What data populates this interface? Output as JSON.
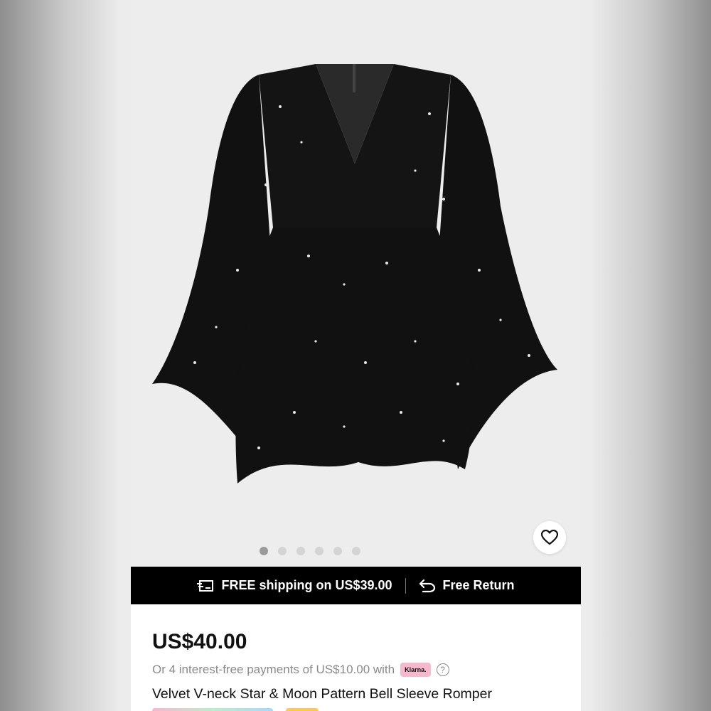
{
  "product": {
    "image_alt": "Black velvet romper with star and moon print and bell sleeves",
    "gallery_count": 6,
    "gallery_active_index": 0
  },
  "banner": {
    "shipping_text": "FREE shipping on US$39.00",
    "return_text": "Free Return"
  },
  "pricing": {
    "price": "US$40.00",
    "installment_text": "Or 4 interest-free payments of US$10.00 with",
    "klarna_label": "Klarna.",
    "help_glyph": "?"
  },
  "title": "Velvet V-neck Star & Moon Pattern Bell Sleeve Romper",
  "colors": {
    "banner_bg": "#000000",
    "klarna_pink": "#f5b8cd",
    "price": "#111111"
  },
  "icons": [
    "heart-icon",
    "shipping-truck-icon",
    "return-arrow-icon",
    "help-icon"
  ]
}
